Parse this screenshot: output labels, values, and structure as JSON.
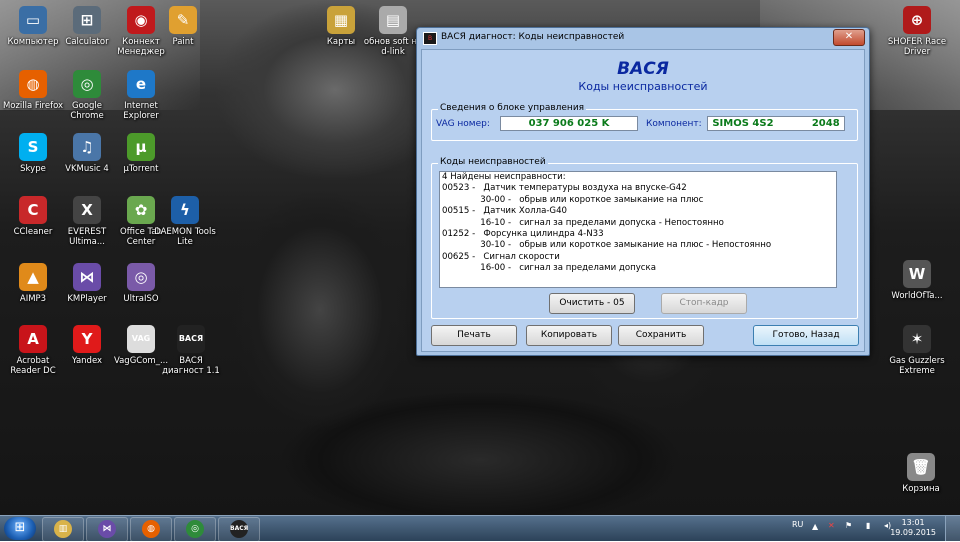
{
  "desktop": {
    "icons": [
      {
        "name": "computer-icon",
        "label": "Компьютер",
        "glyph": "▭",
        "color": "#3a6ea5"
      },
      {
        "name": "calculator-icon",
        "label": "Calculator",
        "glyph": "⊞",
        "color": "#5b6b7a"
      },
      {
        "name": "konnekt-icon",
        "label": "Коннект Менеджер",
        "glyph": "◉",
        "color": "#c0191c"
      },
      {
        "name": "paint-icon",
        "label": "Paint",
        "glyph": "✎",
        "color": "#e0a030"
      },
      {
        "name": "maps-icon",
        "label": "Карты",
        "glyph": "▦",
        "color": "#c9a23a"
      },
      {
        "name": "update-software-icon",
        "label": "обнов soft на d-link",
        "glyph": "▤",
        "color": "#aaa"
      },
      {
        "name": "firefox-icon",
        "label": "Mozilla Firefox",
        "glyph": "◍",
        "color": "#e66000"
      },
      {
        "name": "chrome-icon",
        "label": "Google Chrome",
        "glyph": "◎",
        "color": "#2e8b3a"
      },
      {
        "name": "ie-icon",
        "label": "Internet Explorer",
        "glyph": "e",
        "color": "#1e78c8"
      },
      {
        "name": "skype-icon",
        "label": "Skype",
        "glyph": "S",
        "color": "#00aff0"
      },
      {
        "name": "vkmusic-icon",
        "label": "VKMusic 4",
        "glyph": "♫",
        "color": "#4a76a8"
      },
      {
        "name": "utorrent-icon",
        "label": "µTorrent",
        "glyph": "µ",
        "color": "#4c9a2a"
      },
      {
        "name": "ccleaner-icon",
        "label": "CCleaner",
        "glyph": "C",
        "color": "#c8282a"
      },
      {
        "name": "everest-icon",
        "label": "EVEREST Ultima...",
        "glyph": "X",
        "color": "#444"
      },
      {
        "name": "office-tab-icon",
        "label": "Office Tab Center",
        "glyph": "✿",
        "color": "#6aa84f"
      },
      {
        "name": "daemon-tools-icon",
        "label": "DAEMON Tools Lite",
        "glyph": "ϟ",
        "color": "#1d5fa8"
      },
      {
        "name": "aimp-icon",
        "label": "AIMP3",
        "glyph": "▲",
        "color": "#e08a1a"
      },
      {
        "name": "kmplayer-icon",
        "label": "KMPlayer",
        "glyph": "⋈",
        "color": "#6a4ca8"
      },
      {
        "name": "ultraiso-icon",
        "label": "UltraISO",
        "glyph": "◎",
        "color": "#7a5aa8"
      },
      {
        "name": "acrobat-icon",
        "label": "Acrobat Reader DC",
        "glyph": "A",
        "color": "#c8141a"
      },
      {
        "name": "yandex-icon",
        "label": "Yandex",
        "glyph": "Y",
        "color": "#e01a1a"
      },
      {
        "name": "vaggcom-icon",
        "label": "VagGCom_...",
        "glyph": "VAG",
        "color": "#ddd"
      },
      {
        "name": "vasya-diag-icon",
        "label": "ВАСЯ диагност 1.1",
        "glyph": "ВАСЯ",
        "color": "#222"
      },
      {
        "name": "shofer-icon",
        "label": "SHOFER Race Driver",
        "glyph": "⊕",
        "color": "#b01a1a"
      },
      {
        "name": "world-of-tanks-icon",
        "label": "WorldOfTa...",
        "glyph": "W",
        "color": "#555"
      },
      {
        "name": "gas-guzzlers-icon",
        "label": "Gas Guzzlers Extreme",
        "glyph": "✶",
        "color": "#333"
      },
      {
        "name": "recycle-bin-icon",
        "label": "Корзина",
        "glyph": "🗑",
        "color": "#888"
      }
    ]
  },
  "dialog": {
    "title": "ВАСЯ диагност: Коды неисправностей",
    "close_label": "✕",
    "app_title": "ВАСЯ",
    "app_subtitle": "Коды неисправностей",
    "ecu_group": {
      "legend": "Сведения о блоке управления",
      "vag_label": "VAG номер:",
      "vag_value": "037 906 025 K",
      "component_label": "Компонент:",
      "component_value": "SIMOS 4S2           2048"
    },
    "codes_group": {
      "legend": "Коды неисправностей",
      "lines": [
        "4 Найдены неисправности:",
        "00523 -   Датчик температуры воздуха на впуске-G42",
        "              30-00 -   обрыв или короткое замыкание на плюс",
        "00515 -   Датчик Холла-G40",
        "              16-10 -   сигнал за пределами допуска - Непостоянно",
        "01252 -   Форсунка цилиндра 4-N33",
        "              30-10 -   обрыв или короткое замыкание на плюс - Непостоянно",
        "00625 -   Сигнал скорости",
        "              16-00 -   сигнал за пределами допуска"
      ],
      "clear_button": "Очистить - 05",
      "freeze_button": "Стоп-кадр"
    },
    "buttons": {
      "print": "Печать",
      "copy": "Копировать",
      "save": "Сохранить",
      "done": "Готово, Назад"
    }
  },
  "taskbar": {
    "language": "RU",
    "time": "13:01",
    "date": "19.09.2015",
    "pinned": [
      {
        "name": "explorer-icon",
        "glyph": "▥",
        "color": "#d9b34a"
      },
      {
        "name": "kmplayer-task-icon",
        "glyph": "⋈",
        "color": "#6a4ca8"
      },
      {
        "name": "firefox-task-icon",
        "glyph": "◍",
        "color": "#e66000"
      },
      {
        "name": "chrome-task-icon",
        "glyph": "◎",
        "color": "#2e8b3a"
      },
      {
        "name": "vasya-task-icon",
        "glyph": "ВАСЯ",
        "color": "#222"
      }
    ]
  }
}
